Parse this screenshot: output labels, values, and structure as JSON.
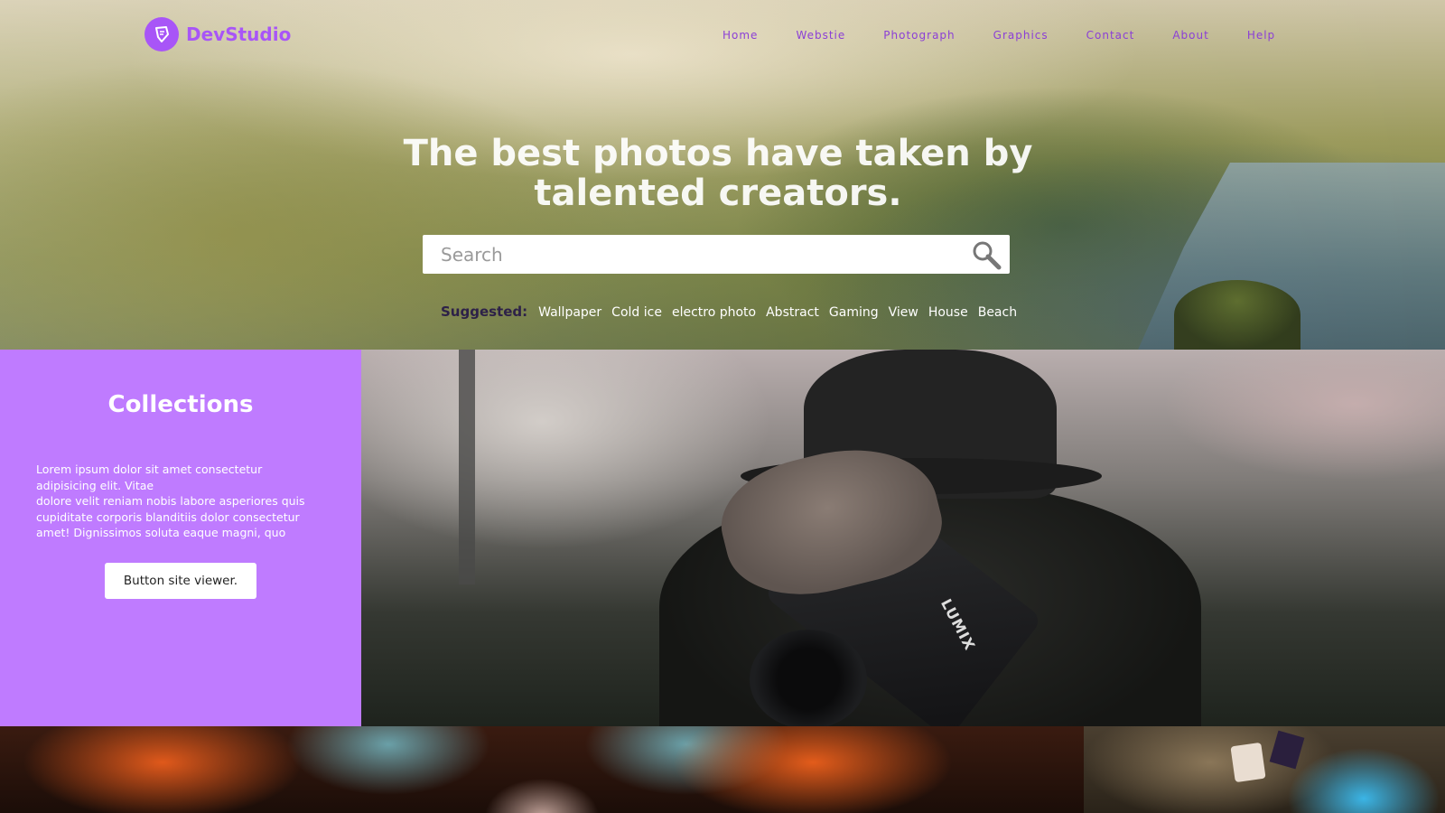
{
  "brand": {
    "name": "DevStudio"
  },
  "nav": {
    "items": [
      "Home",
      "Webstie",
      "Photograph",
      "Graphics",
      "Contact",
      "About",
      "Help"
    ]
  },
  "hero": {
    "headline_line1": "The best photos have taken by",
    "headline_line2": "talented creators.",
    "search_placeholder": "Search",
    "suggested_label": "Suggested:",
    "tags": [
      "Wallpaper",
      "Cold ice",
      "electro photo",
      "Abstract",
      "Gaming",
      "View",
      "House",
      "Beach"
    ]
  },
  "collections": {
    "title": "Collections",
    "text_line1": "Lorem ipsum dolor sit amet consectetur adipisicing elit. Vitae",
    "text_line2": "dolore velit reniam nobis labore asperiores quis cupiditate corporis blanditiis dolor consectetur amet! Dignissimos soluta eaque magni, quo",
    "button_label": "Button site viewer."
  },
  "photo": {
    "camera_brand": "LUMIX"
  },
  "colors": {
    "accent": "#a855f7",
    "panel": "#bf7bff",
    "nav_text": "#8b3fd6"
  }
}
